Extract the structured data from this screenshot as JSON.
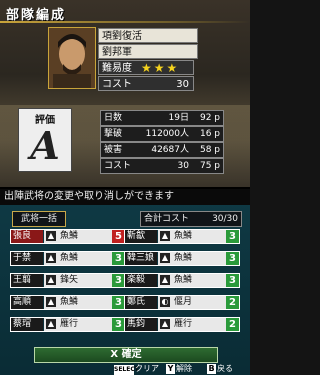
{
  "screen_title": "部隊編成",
  "scenario": {
    "title": "項劉復活",
    "faction": "劉邦軍",
    "difficulty_label": "難易度",
    "difficulty_stars": "★★★",
    "cost_label": "コスト",
    "cost_value": "30"
  },
  "evaluation": {
    "label": "評価",
    "grade": "A"
  },
  "stats": [
    {
      "label": "日数",
      "value": "19日",
      "points": "92 p"
    },
    {
      "label": "撃破",
      "value": "112000人",
      "points": "16 p"
    },
    {
      "label": "被害",
      "value": "42687人",
      "points": "58 p"
    },
    {
      "label": "コスト",
      "value": "30",
      "points": "75 p"
    }
  ],
  "message": "出陣武将の変更や取り消しができます",
  "bulk_button": "武将一括",
  "total_cost": {
    "label": "合計コスト",
    "value": "30/30"
  },
  "units": [
    {
      "name": "張良",
      "type_icon": "▲",
      "type": "魚鱗",
      "cost": "5",
      "name_style": "red",
      "cost_style": "red"
    },
    {
      "name": "靳歙",
      "type_icon": "▲",
      "type": "魚鱗",
      "cost": "3",
      "name_style": "dark",
      "cost_style": "green"
    },
    {
      "name": "于禁",
      "type_icon": "▲",
      "type": "魚鱗",
      "cost": "3",
      "name_style": "dark",
      "cost_style": "green"
    },
    {
      "name": "韓三娘",
      "type_icon": "▲",
      "type": "魚鱗",
      "cost": "3",
      "name_style": "dark",
      "cost_style": "green"
    },
    {
      "name": "王翦",
      "type_icon": "▲",
      "type": "鋒矢",
      "cost": "3",
      "name_style": "dark",
      "cost_style": "green"
    },
    {
      "name": "楽毅",
      "type_icon": "▲",
      "type": "魚鱗",
      "cost": "3",
      "name_style": "dark",
      "cost_style": "green"
    },
    {
      "name": "高順",
      "type_icon": "▲",
      "type": "魚鱗",
      "cost": "3",
      "name_style": "dark",
      "cost_style": "green"
    },
    {
      "name": "鄭氏",
      "type_icon": "◐",
      "type": "偃月",
      "cost": "2",
      "name_style": "dark",
      "cost_style": "green"
    },
    {
      "name": "蔡瑁",
      "type_icon": "▲",
      "type": "雁行",
      "cost": "3",
      "name_style": "dark",
      "cost_style": "green"
    },
    {
      "name": "馬鈞",
      "type_icon": "▲",
      "type": "雁行",
      "cost": "2",
      "name_style": "dark",
      "cost_style": "green"
    }
  ],
  "confirm_button": {
    "key": "X",
    "label": "確定"
  },
  "footer": {
    "clear": {
      "key": "SELECT",
      "label": "クリア"
    },
    "remove": {
      "key": "Y",
      "label": "解除"
    },
    "back": {
      "key": "B",
      "label": "戻る"
    }
  },
  "colors": {
    "accent_gold": "#c9a43a",
    "confirm_green": "#2e6b31",
    "cost_red": "#c02020",
    "cost_green": "#2a9a3a"
  }
}
